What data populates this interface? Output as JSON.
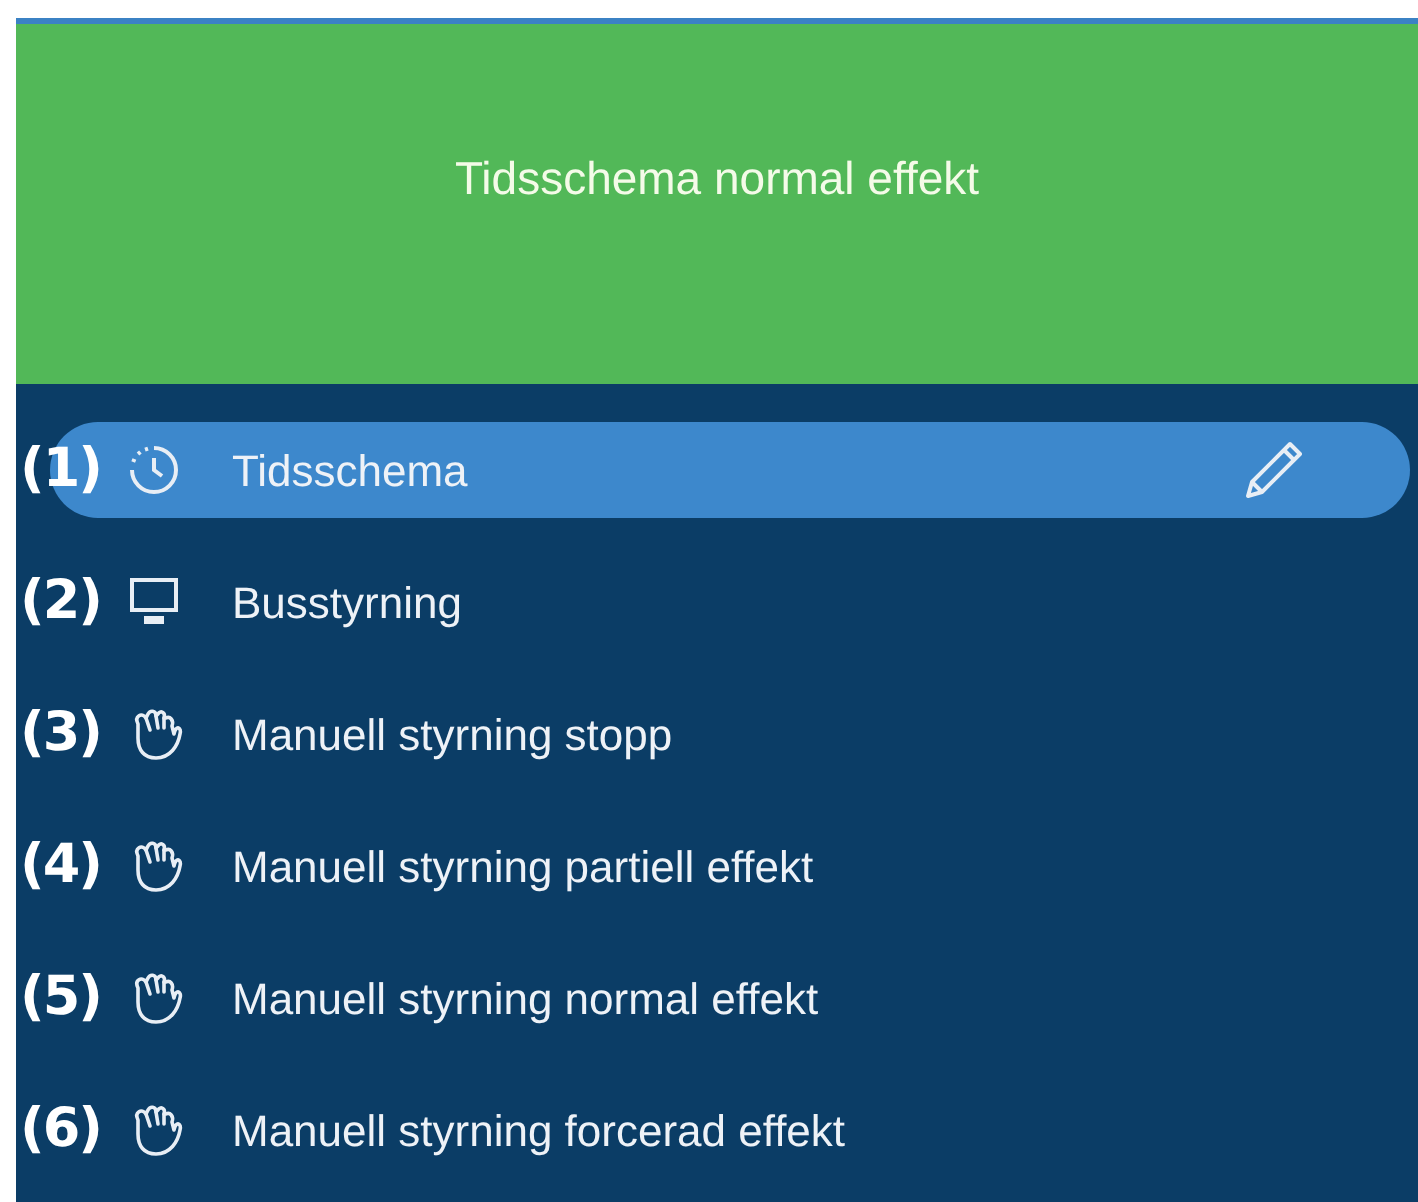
{
  "header": {
    "title": "Tidsschema normal effekt"
  },
  "menu": [
    {
      "number": "(1)",
      "kind": "clock",
      "label": "Tidsschema",
      "selected": true
    },
    {
      "number": "(2)",
      "kind": "monitor",
      "label": "Busstyrning",
      "selected": false
    },
    {
      "number": "(3)",
      "kind": "hand",
      "label": "Manuell styrning stopp",
      "selected": false
    },
    {
      "number": "(4)",
      "kind": "hand",
      "label": "Manuell styrning partiell effekt",
      "selected": false
    },
    {
      "number": "(5)",
      "kind": "hand",
      "label": "Manuell styrning normal effekt",
      "selected": false
    },
    {
      "number": "(6)",
      "kind": "hand",
      "label": "Manuell styrning forcerad effekt",
      "selected": false
    }
  ]
}
